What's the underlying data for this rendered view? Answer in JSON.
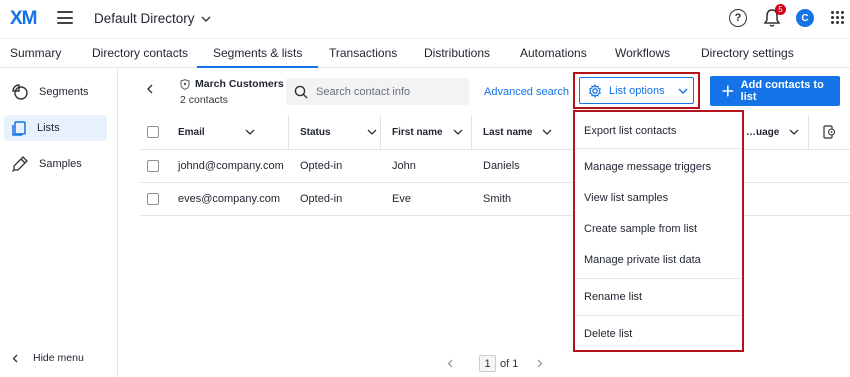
{
  "header": {
    "logo": "XM",
    "directory": "Default Directory",
    "help": "?",
    "notification_count": "5",
    "avatar_initial": "C"
  },
  "tabs": [
    {
      "label": "Summary"
    },
    {
      "label": "Directory contacts"
    },
    {
      "label": "Segments & lists",
      "active": true
    },
    {
      "label": "Transactions"
    },
    {
      "label": "Distributions"
    },
    {
      "label": "Automations"
    },
    {
      "label": "Workflows"
    },
    {
      "label": "Directory settings"
    }
  ],
  "sidebar": {
    "items": [
      {
        "label": "Segments",
        "icon": "segments-icon"
      },
      {
        "label": "Lists",
        "icon": "lists-icon",
        "active": true
      },
      {
        "label": "Samples",
        "icon": "samples-icon"
      }
    ],
    "hide_menu": "Hide menu"
  },
  "list": {
    "name": "March Customers",
    "count": "2 contacts"
  },
  "search": {
    "placeholder": "Search contact info"
  },
  "toolbar": {
    "advanced_search": "Advanced search",
    "list_options": "List options",
    "add_contacts": "Add contacts to list"
  },
  "table": {
    "columns": [
      "Email",
      "Status",
      "First name",
      "Last name",
      "…uage"
    ],
    "rows": [
      {
        "email": "johnd@company.com",
        "status": "Opted-in",
        "first": "John",
        "last": "Daniels"
      },
      {
        "email": "eves@company.com",
        "status": "Opted-in",
        "first": "Eve",
        "last": "Smith"
      }
    ]
  },
  "menu": {
    "items": [
      "Export list contacts",
      "Manage message triggers",
      "View list samples",
      "Create sample from list",
      "Manage private list data",
      "Rename list",
      "Delete list"
    ]
  },
  "pagination": {
    "page": "1",
    "of_label": "of 1"
  },
  "colors": {
    "accent": "#1473e6",
    "highlight_outline": "#b5121b",
    "badge": "#d0021b"
  }
}
